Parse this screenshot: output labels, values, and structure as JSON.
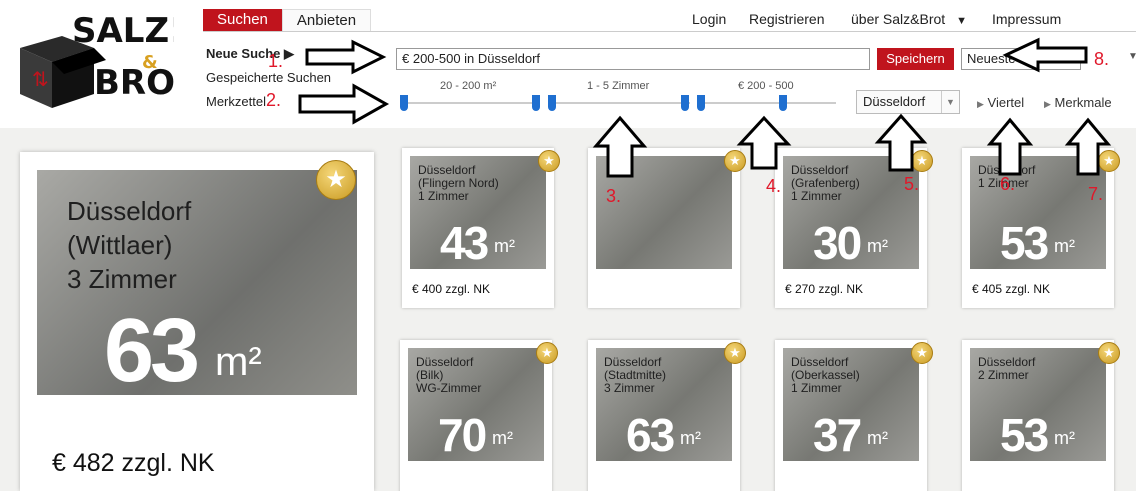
{
  "tabs": [
    {
      "label": "Suchen"
    },
    {
      "label": "Anbieten"
    }
  ],
  "topnav": {
    "login": "Login",
    "register": "Registrieren",
    "about": "über Salz&Brot",
    "imprint": "Impressum"
  },
  "logo": {
    "line1": "SALZ!",
    "amp": "&",
    "line2": "BROT"
  },
  "sidebar": {
    "new_search": "Neue Suche",
    "saved_searches": "Gespeicherte Suchen",
    "notepad": "Merkzettel"
  },
  "search": {
    "value": "€ 200-500 in Düsseldorf",
    "save_label": "Speichern"
  },
  "sort": {
    "selected": "Neueste zuerst"
  },
  "filters": {
    "area": {
      "label": "20 - 200 m²"
    },
    "rooms": {
      "label": "1 - 5 Zimmer"
    },
    "price": {
      "label": "€ 200 - 500"
    },
    "city": "Düsseldorf",
    "district_link": "Viertel",
    "features_link": "Merkmale"
  },
  "annotations": [
    "1.",
    "2.",
    "3.",
    "4.",
    "5.",
    "6.",
    "7.",
    "8."
  ],
  "featured": {
    "city": "Düsseldorf",
    "district": "(Wittlaer)",
    "rooms": "3 Zimmer",
    "area": "63",
    "unit": "m²",
    "price": "€ 482 zzgl. NK"
  },
  "listings": [
    {
      "city": "Düsseldorf",
      "district": "(Flingern Nord)",
      "rooms": "1 Zimmer",
      "area": "43",
      "unit": "m²",
      "price": "€ 400 zzgl. NK"
    },
    {
      "city": "",
      "district": "",
      "rooms": "",
      "area": "",
      "unit": "",
      "price": ""
    },
    {
      "city": "Düsseldorf",
      "district": "(Grafenberg)",
      "rooms": "1 Zimmer",
      "area": "30",
      "unit": "m²",
      "price": "€ 270 zzgl. NK"
    },
    {
      "city": "Düsseldorf",
      "district": "",
      "rooms": "1 Zimmer",
      "area": "53",
      "unit": "m²",
      "price": "€ 405 zzgl. NK"
    },
    {
      "city": "Düsseldorf",
      "district": "(Bilk)",
      "rooms": "WG-Zimmer",
      "area": "70",
      "unit": "m²",
      "price": ""
    },
    {
      "city": "Düsseldorf",
      "district": "(Stadtmitte)",
      "rooms": "3 Zimmer",
      "area": "63",
      "unit": "m²",
      "price": ""
    },
    {
      "city": "Düsseldorf",
      "district": "(Oberkassel)",
      "rooms": "1 Zimmer",
      "area": "37",
      "unit": "m²",
      "price": ""
    },
    {
      "city": "Düsseldorf",
      "district": "",
      "rooms": "2 Zimmer",
      "area": "53",
      "unit": "m²",
      "price": ""
    }
  ],
  "colors": {
    "accent": "#c0141d",
    "handle": "#1f6fd0",
    "annotation": "#e0182a"
  }
}
